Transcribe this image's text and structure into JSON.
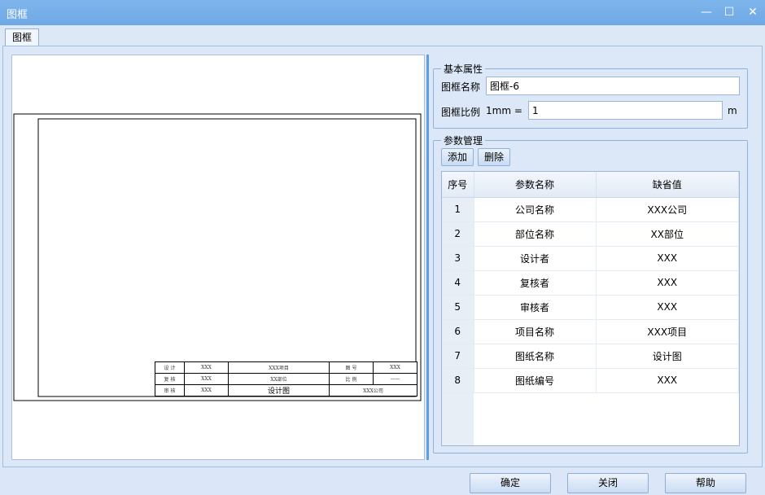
{
  "window": {
    "title": "图框",
    "minimize": "—",
    "maximize": "☐",
    "close": "✕"
  },
  "tab": {
    "label": "图框"
  },
  "basic": {
    "legend": "基本属性",
    "name_label": "图框名称",
    "name_value": "图框-6",
    "scale_label": "图框比例",
    "scale_prefix": "1mm =",
    "scale_value": "1",
    "scale_unit": "m"
  },
  "params": {
    "legend": "参数管理",
    "add": "添加",
    "delete": "删除",
    "columns": [
      "序号",
      "参数名称",
      "缺省值"
    ],
    "rows": [
      [
        "1",
        "公司名称",
        "XXX公司"
      ],
      [
        "2",
        "部位名称",
        "XX部位"
      ],
      [
        "3",
        "设计者",
        "XXX"
      ],
      [
        "4",
        "复核者",
        "XXX"
      ],
      [
        "5",
        "审核者",
        "XXX"
      ],
      [
        "6",
        "项目名称",
        "XXX项目"
      ],
      [
        "7",
        "图纸名称",
        "设计图"
      ],
      [
        "8",
        "图纸编号",
        "XXX"
      ]
    ]
  },
  "titleblock": {
    "r1": [
      "设 计",
      "XXX",
      "XXX项目",
      "图 号",
      "XXX"
    ],
    "r2": [
      "复 核",
      "XXX",
      "XX部位",
      "比 例",
      "——"
    ],
    "r3": [
      "审 核",
      "XXX",
      "设计图",
      "XXX公司"
    ]
  },
  "footer": {
    "ok": "确定",
    "close": "关闭",
    "help": "帮助"
  }
}
